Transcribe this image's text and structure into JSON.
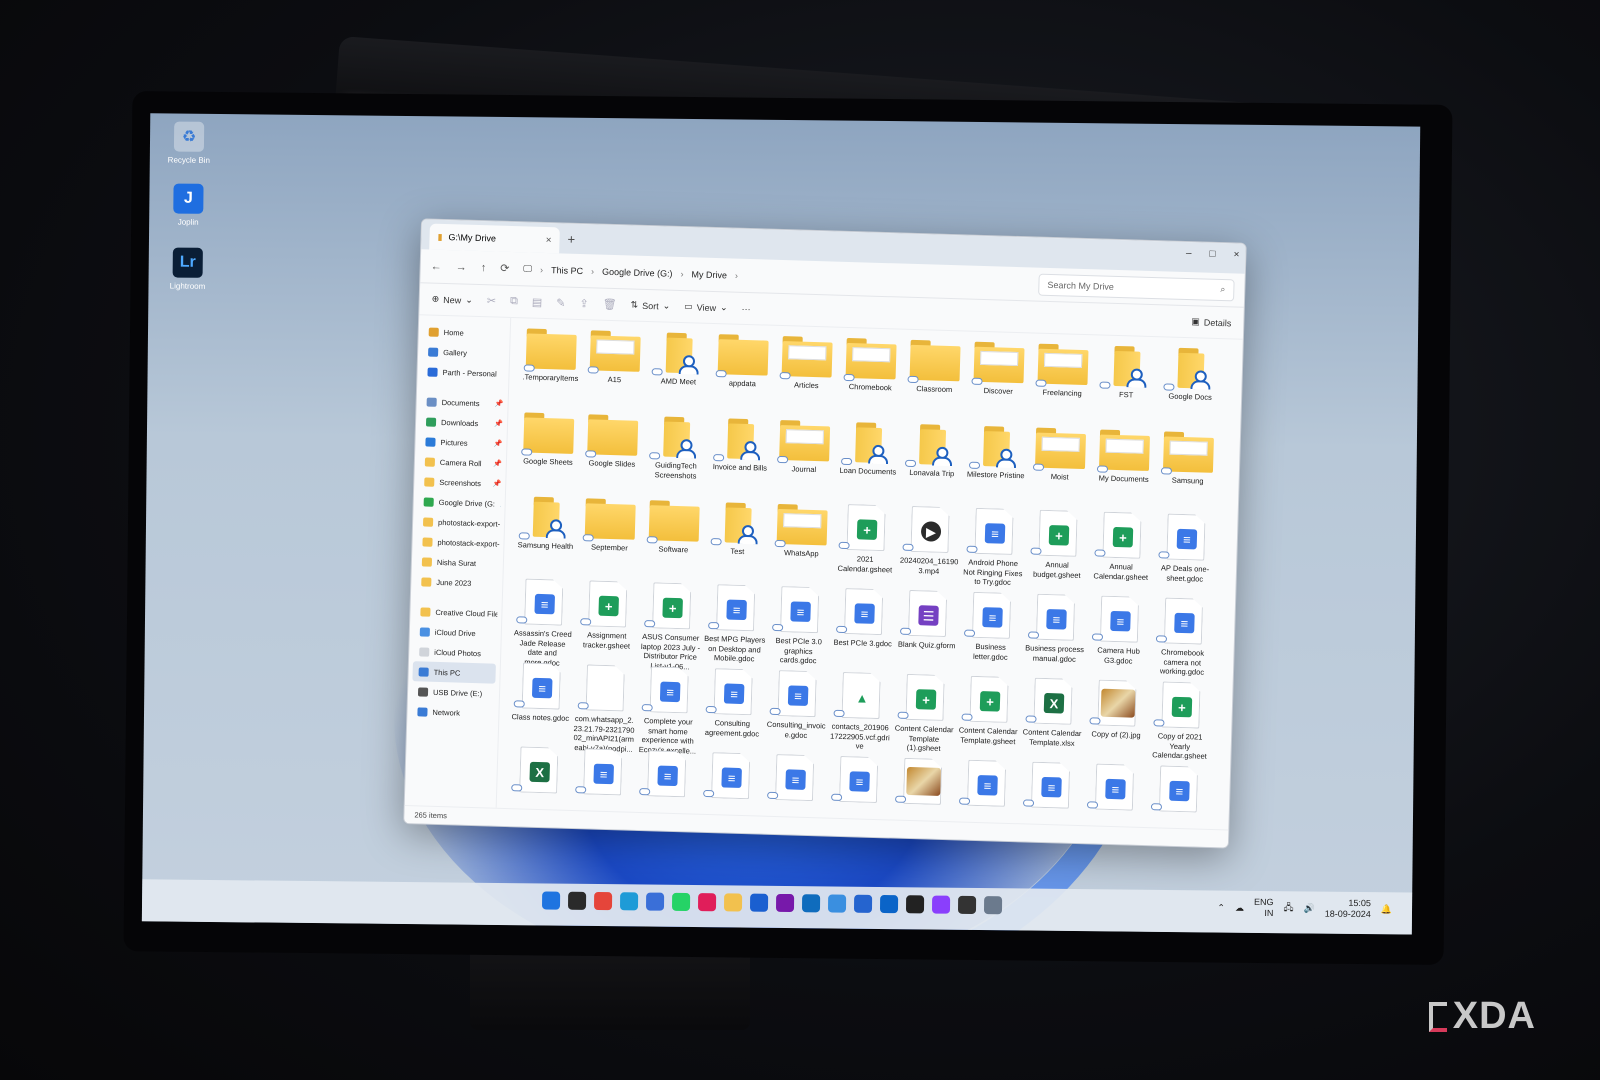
{
  "desktop": {
    "icons": [
      {
        "label": "Recycle Bin",
        "icon": "recycle-bin-icon"
      },
      {
        "label": "Joplin",
        "icon": "joplin-icon"
      },
      {
        "label": "Lightroom",
        "icon": "lightroom-icon"
      }
    ]
  },
  "explorer": {
    "tab_title": "G:\\My Drive",
    "tab_close": "×",
    "new_tab": "+",
    "window_controls": [
      "–",
      "□",
      "×"
    ],
    "nav": [
      "←",
      "→",
      "↑",
      "⟳"
    ],
    "breadcrumb": [
      "This PC",
      "Google Drive (G:)",
      "My Drive"
    ],
    "search_placeholder": "Search My Drive",
    "toolbar": {
      "new_label": "New",
      "sort_label": "Sort",
      "view_label": "View",
      "more_label": "···",
      "details_label": "Details"
    },
    "sidebar": [
      {
        "label": "Home",
        "color": "#e0a030",
        "pinned": false
      },
      {
        "label": "Gallery",
        "color": "#3a7bd5",
        "pinned": false
      },
      {
        "label": "Parth - Personal",
        "color": "#2a6bd8",
        "pinned": false
      },
      {
        "label": "Documents",
        "color": "#6b8fc4",
        "pinned": true
      },
      {
        "label": "Downloads",
        "color": "#2f9e5c",
        "pinned": true
      },
      {
        "label": "Pictures",
        "color": "#2b7bd8",
        "pinned": true
      },
      {
        "label": "Camera Roll",
        "color": "#f2c14e",
        "pinned": true
      },
      {
        "label": "Screenshots",
        "color": "#f2c14e",
        "pinned": true
      },
      {
        "label": "Google Drive (G:",
        "color": "#2fa84f",
        "pinned": true
      },
      {
        "label": "photostack-export-",
        "color": "#f2c14e",
        "pinned": false
      },
      {
        "label": "photostack-export-",
        "color": "#f2c14e",
        "pinned": false
      },
      {
        "label": "Nisha Surat",
        "color": "#f2c14e",
        "pinned": false
      },
      {
        "label": "June 2023",
        "color": "#f2c14e",
        "pinned": false
      },
      {
        "label": "Creative Cloud Files",
        "color": "#f2c14e",
        "pinned": false
      },
      {
        "label": "iCloud Drive",
        "color": "#4a90e2",
        "pinned": false
      },
      {
        "label": "iCloud Photos",
        "color": "#d0d4da",
        "pinned": false
      },
      {
        "label": "This PC",
        "color": "#3a7bd5",
        "pinned": false,
        "selected": true
      },
      {
        "label": "USB Drive (E:)",
        "color": "#555555",
        "pinned": false
      },
      {
        "label": "Network",
        "color": "#3a7bd5",
        "pinned": false
      }
    ],
    "pin_glyph": "📌",
    "files": [
      {
        "name": ".TemporaryItems",
        "type": "folder"
      },
      {
        "name": "A15",
        "type": "folder-paper"
      },
      {
        "name": "AMD Meet",
        "type": "shared"
      },
      {
        "name": "appdata",
        "type": "folder"
      },
      {
        "name": "Articles",
        "type": "folder-paper"
      },
      {
        "name": "Chromebook",
        "type": "folder-paper"
      },
      {
        "name": "Classroom",
        "type": "folder"
      },
      {
        "name": "Discover",
        "type": "folder-paper"
      },
      {
        "name": "Freelancing",
        "type": "folder-paper"
      },
      {
        "name": "FST",
        "type": "shared"
      },
      {
        "name": "Google Docs",
        "type": "shared"
      },
      {
        "name": "Google Sheets",
        "type": "folder"
      },
      {
        "name": "Google Slides",
        "type": "folder"
      },
      {
        "name": "GuidingTech Screenshots",
        "type": "shared"
      },
      {
        "name": "Invoice and Bills",
        "type": "shared"
      },
      {
        "name": "Journal",
        "type": "folder-paper"
      },
      {
        "name": "Loan Documents",
        "type": "shared"
      },
      {
        "name": "Lonavala Trip",
        "type": "shared"
      },
      {
        "name": "Milestore Pristine",
        "type": "shared"
      },
      {
        "name": "Moist",
        "type": "folder-paper"
      },
      {
        "name": "My Documents",
        "type": "folder-paper"
      },
      {
        "name": "Samsung",
        "type": "folder-paper"
      },
      {
        "name": "Samsung Health",
        "type": "shared"
      },
      {
        "name": "September",
        "type": "folder"
      },
      {
        "name": "Software",
        "type": "folder"
      },
      {
        "name": "Test",
        "type": "shared"
      },
      {
        "name": "WhatsApp",
        "type": "folder-paper"
      },
      {
        "name": "2021 Calendar.gsheet",
        "type": "gsheet"
      },
      {
        "name": "20240204_16190 3.mp4",
        "type": "video"
      },
      {
        "name": "Android Phone Not Ringing Fixes to Try.gdoc",
        "type": "gdoc"
      },
      {
        "name": "Annual budget.gsheet",
        "type": "gsheet"
      },
      {
        "name": "Annual Calendar.gsheet",
        "type": "gsheet"
      },
      {
        "name": "AP Deals one-sheet.gdoc",
        "type": "gdoc"
      },
      {
        "name": "Assassin's Creed Jade Release date and more.gdoc",
        "type": "gdoc"
      },
      {
        "name": "Assignment tracker.gsheet",
        "type": "gsheet"
      },
      {
        "name": "ASUS Consumer laptop 2023 July - Distributor Price List-v1-06...",
        "type": "gsheet"
      },
      {
        "name": "Best MPG Players on Desktop and Mobile.gdoc",
        "type": "gdoc"
      },
      {
        "name": "Best PCIe 3.0 graphics cards.gdoc",
        "type": "gdoc"
      },
      {
        "name": "Best PCIe 3.gdoc",
        "type": "gdoc"
      },
      {
        "name": "Blank Quiz.gform",
        "type": "form"
      },
      {
        "name": "Business letter.gdoc",
        "type": "gdoc"
      },
      {
        "name": "Business process manual.gdoc",
        "type": "gdoc"
      },
      {
        "name": "Camera Hub G3.gdoc",
        "type": "gdoc"
      },
      {
        "name": "Chromebook camera not working.gdoc",
        "type": "gdoc"
      },
      {
        "name": "Class notes.gdoc",
        "type": "gdoc"
      },
      {
        "name": "com.whatsapp_2. 23.21.79-2321790 02_minAPI21(arm eabi-v7a)(nodpi...",
        "type": "blank"
      },
      {
        "name": "Complete your smart home experience with Ecozy's excelle...",
        "type": "gdoc"
      },
      {
        "name": "Consulting agreement.gdoc",
        "type": "gdoc"
      },
      {
        "name": "Consulting_invoic e.gdoc",
        "type": "gdoc"
      },
      {
        "name": "contacts_201906 17222905.vcf.gdri ve",
        "type": "drive"
      },
      {
        "name": "Content Calendar Template (1).gsheet",
        "type": "gsheet"
      },
      {
        "name": "Content Calendar Template.gsheet",
        "type": "gsheet"
      },
      {
        "name": "Content Calendar Template.xlsx",
        "type": "xlsx"
      },
      {
        "name": "Copy of (2).jpg",
        "type": "jpg"
      },
      {
        "name": "Copy of 2021 Yearly Calendar.gsheet",
        "type": "gsheet"
      },
      {
        "name": "",
        "type": "xlsx"
      },
      {
        "name": "",
        "type": "gdoc"
      },
      {
        "name": "",
        "type": "gdoc"
      },
      {
        "name": "",
        "type": "gdoc"
      },
      {
        "name": "",
        "type": "gdoc"
      },
      {
        "name": "",
        "type": "gdoc"
      },
      {
        "name": "",
        "type": "jpg"
      },
      {
        "name": "",
        "type": "gdoc"
      },
      {
        "name": "",
        "type": "gdoc"
      },
      {
        "name": "",
        "type": "gdoc"
      },
      {
        "name": "",
        "type": "gdoc"
      }
    ],
    "status": "265 items"
  },
  "taskbar": {
    "apps": [
      {
        "icon": "start-icon",
        "color": "#1f74e0"
      },
      {
        "icon": "task-view-icon",
        "color": "#2a2a2a"
      },
      {
        "icon": "chrome-icon",
        "color": "#e5453a"
      },
      {
        "icon": "edge-icon",
        "color": "#1e9bd7"
      },
      {
        "icon": "store-icon",
        "color": "#3a6fd8"
      },
      {
        "icon": "whatsapp-icon",
        "color": "#25d366"
      },
      {
        "icon": "slack-icon",
        "color": "#e01e5a"
      },
      {
        "icon": "file-explorer-icon",
        "color": "#f2c14e"
      },
      {
        "icon": "1password-icon",
        "color": "#1a5fd0"
      },
      {
        "icon": "onenote-icon",
        "color": "#7719aa"
      },
      {
        "icon": "outlook-icon",
        "color": "#0f6cbd"
      },
      {
        "icon": "photos-icon",
        "color": "#3a8fe0"
      },
      {
        "icon": "todo-icon",
        "color": "#2564cf"
      },
      {
        "icon": "outlook-new-icon",
        "color": "#0a64c8"
      },
      {
        "icon": "notion-icon",
        "color": "#222222"
      },
      {
        "icon": "clipchamp-icon",
        "color": "#8a3ffc"
      },
      {
        "icon": "terminal-icon",
        "color": "#333333"
      },
      {
        "icon": "settings-icon",
        "color": "#6b7a8d"
      }
    ],
    "tray": {
      "lang": "ENG",
      "region": "IN",
      "time": "15:05",
      "date": "18-09-2024"
    }
  },
  "watermark": "XDA"
}
